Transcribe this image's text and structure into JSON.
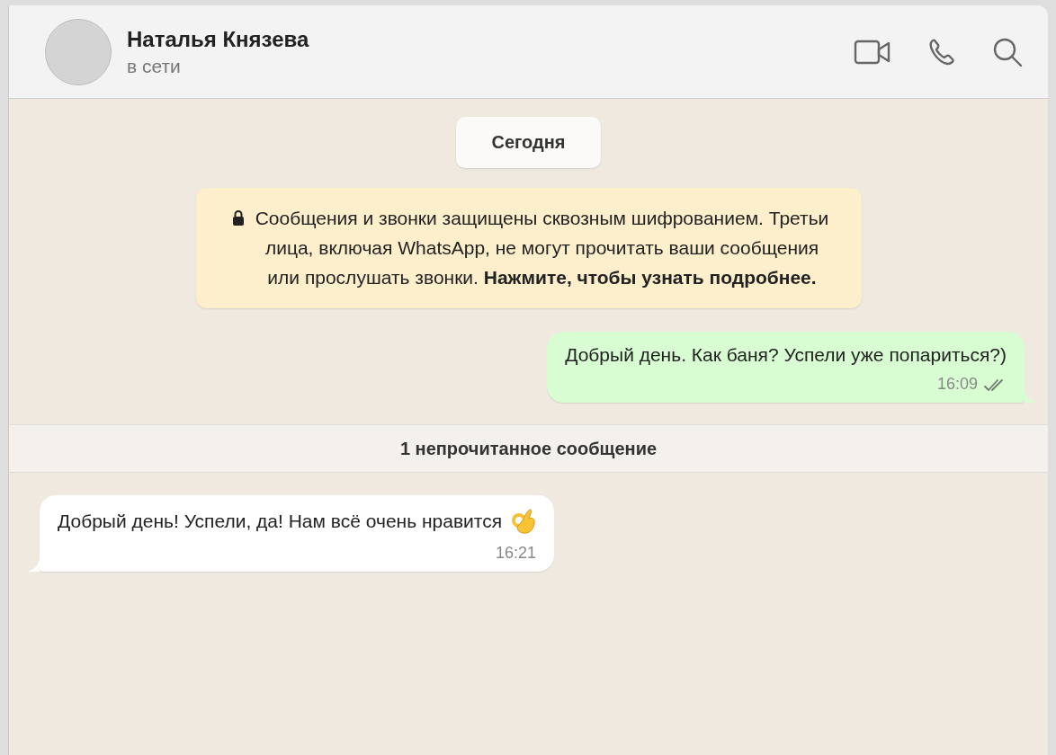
{
  "contact": {
    "name": "Наталья Князева",
    "status": "в сети"
  },
  "chat": [
    {
      "kind": "date",
      "text": "Сегодня"
    },
    {
      "kind": "notice",
      "text": "Сообщения и звонки защищены сквозным шифрованием. Третьи лица, включая WhatsApp, не могут прочитать ваши сообщения или прослушать звонки. **Нажмите, чтобы узнать подробнее.**"
    },
    {
      "kind": "outgoing",
      "text": "Добрый день. Как баня? Успели уже попариться?)",
      "time": "16:09",
      "delivered": true,
      "read": false
    },
    {
      "kind": "unread_divider",
      "text": "1 непрочитанное сообщение"
    },
    {
      "kind": "incoming",
      "text": "Добрый день! Успели, да! Нам всё очень нравится",
      "time": "16:21",
      "ok_hand_emoji": true
    }
  ]
}
